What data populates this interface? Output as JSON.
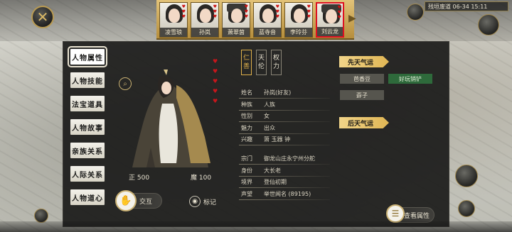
{
  "close_button": {
    "icon": "close-x-icon",
    "glyph": "✕"
  },
  "portraits": [
    {
      "name": "凌雪琅",
      "hat": false,
      "active": false
    },
    {
      "name": "孙岚",
      "hat": false,
      "active": false
    },
    {
      "name": "萧翠茵",
      "hat": true,
      "active": false
    },
    {
      "name": "蓝寺音",
      "hat": false,
      "active": false
    },
    {
      "name": "李玲芬",
      "hat": false,
      "active": false
    },
    {
      "name": "刘云龙",
      "hat": true,
      "active": true
    }
  ],
  "hud": {
    "date": "残垣废道 06-34 15:11"
  },
  "side_tabs": [
    {
      "label": "人物属性",
      "active": true
    },
    {
      "label": "人物技能",
      "active": false
    },
    {
      "label": "法宝道具",
      "active": false
    },
    {
      "label": "人物故事",
      "active": false
    },
    {
      "label": "亲族关系",
      "active": false
    },
    {
      "label": "人际关系",
      "active": false
    },
    {
      "label": "人物道心",
      "active": false
    }
  ],
  "virtues": [
    {
      "chars": [
        "仁",
        "善"
      ],
      "active": true
    },
    {
      "chars": [
        "天",
        "伦"
      ],
      "active": false
    },
    {
      "chars": [
        "权",
        "力"
      ],
      "active": false
    }
  ],
  "stats": {
    "righteous": "正 500",
    "demonic": "魔 100"
  },
  "info_group1": [
    {
      "key": "姓名",
      "value": "孙岚(好友)"
    },
    {
      "key": "种族",
      "value": "人族"
    },
    {
      "key": "性别",
      "value": "女"
    },
    {
      "key": "魅力",
      "value": "出众"
    },
    {
      "key": "兴趣",
      "value": "箫    玉器   钟"
    }
  ],
  "info_group2": [
    {
      "key": "宗门",
      "value": "御龙山庄永宁州分舵"
    },
    {
      "key": "身份",
      "value": "大长老"
    },
    {
      "key": "境界",
      "value": "登仙初期"
    },
    {
      "key": "声望",
      "value": "举世闻名 (89195)"
    }
  ],
  "fate": {
    "innate_title": "先天气运",
    "innate_items": [
      {
        "label": "芭香豆",
        "good": false
      },
      {
        "label": "好玩销铲",
        "good": true
      },
      {
        "label": "孬子",
        "good": false
      }
    ],
    "acquired_title": "后天气运"
  },
  "buttons": {
    "interact": "交互",
    "mark": "标记",
    "view_attributes": "查看属性"
  },
  "colors": {
    "panel": "#1c1c1b",
    "accent_gold": "#e2b24a",
    "good_green": "#2e6a3b",
    "heart_red": "#c8161b"
  }
}
